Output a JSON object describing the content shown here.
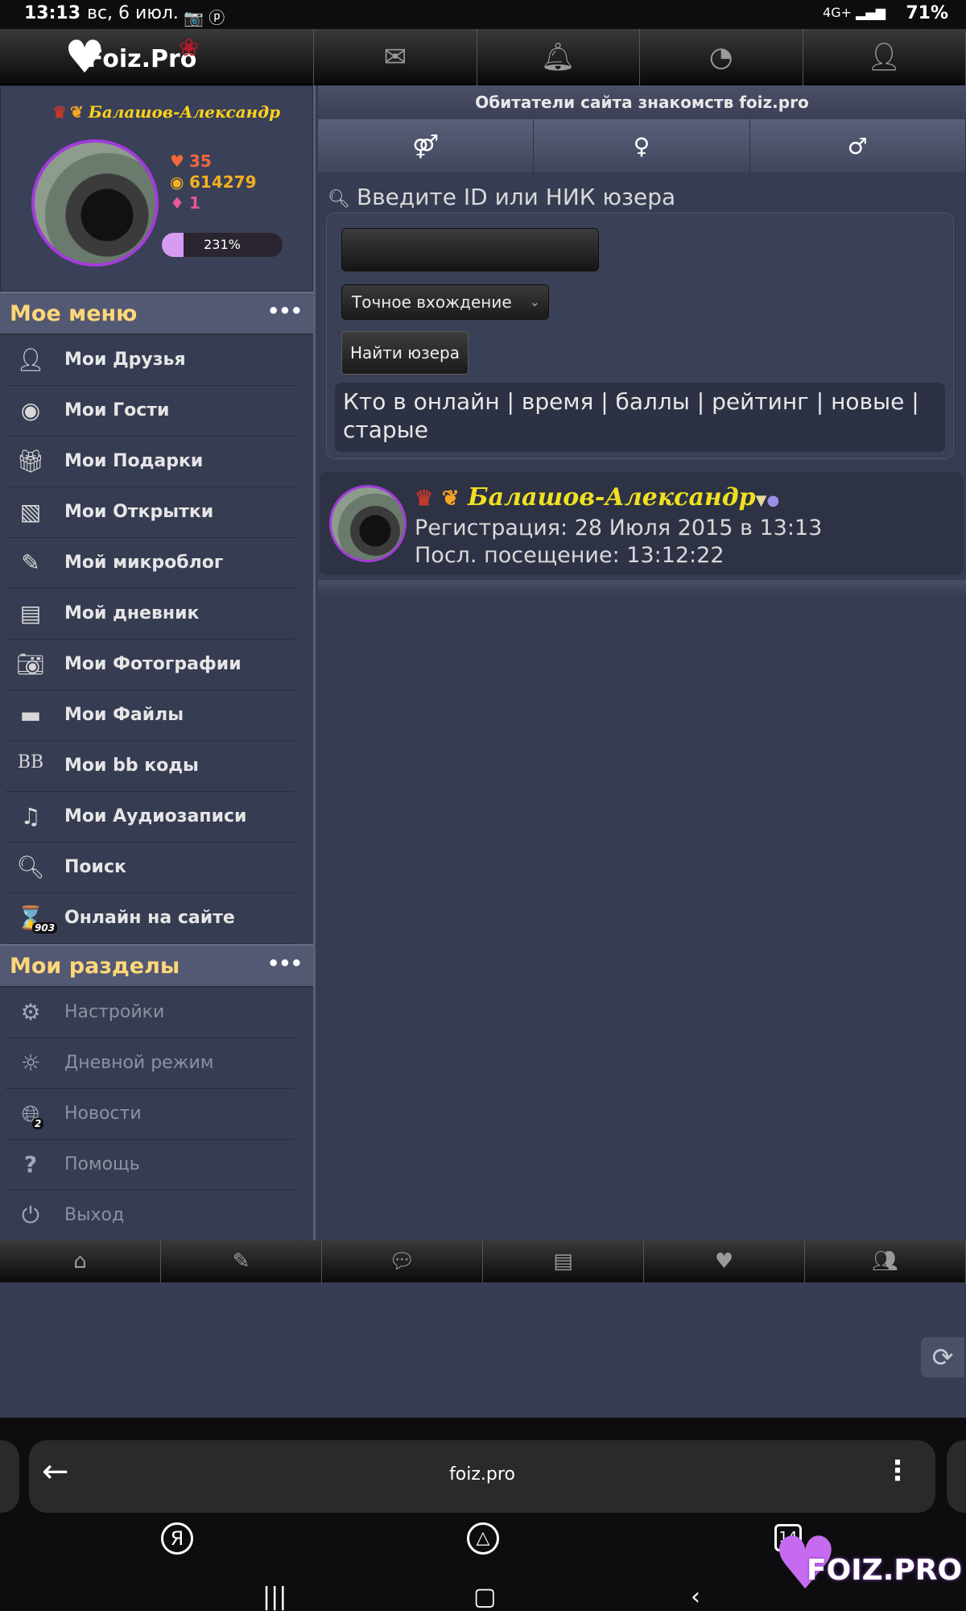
{
  "status": {
    "time": "13:13",
    "date": "вс, 6 июл.",
    "icons": "📷 ⓟ",
    "signal": "4G+ ▂▄▆",
    "battery": "71%"
  },
  "header": {
    "logo_text": "Foiz.Pro",
    "nav_icons": [
      "envelope-icon",
      "bell-icon",
      "rss-icon",
      "user-icon"
    ]
  },
  "profile": {
    "name": "Балашов-Александр",
    "hearts": "35",
    "coins": "614279",
    "gems": "1",
    "progress_label": "231%",
    "progress_fraction": 0.18
  },
  "menu": {
    "title": "Мое меню",
    "dots": "•••",
    "items": [
      {
        "label": "Мои Друзья",
        "icon": "friends-icon"
      },
      {
        "label": "Мои Гости",
        "icon": "eye-icon"
      },
      {
        "label": "Мои Подарки",
        "icon": "gift-icon"
      },
      {
        "label": "Мои Открытки",
        "icon": "postcard-icon"
      },
      {
        "label": "Мой микроблог",
        "icon": "edit-icon"
      },
      {
        "label": "Мой дневник",
        "icon": "book-icon"
      },
      {
        "label": "Мои Фотографии",
        "icon": "camera-icon"
      },
      {
        "label": "Мои Файлы",
        "icon": "folder-icon"
      },
      {
        "label": "Мои bb коды",
        "icon": "bb-icon"
      },
      {
        "label": "Мои Аудиозаписи",
        "icon": "music-icon"
      },
      {
        "label": "Поиск",
        "icon": "search-icon"
      },
      {
        "label": "Онлайн на сайте",
        "icon": "online-icon",
        "badge": "903"
      }
    ]
  },
  "sections": {
    "title": "Мои разделы",
    "dots": "•••",
    "items": [
      {
        "label": "Настройки",
        "icon": "gear-icon"
      },
      {
        "label": "Дневной режим",
        "icon": "sun-icon"
      },
      {
        "label": "Новости",
        "icon": "globe-icon",
        "badge": "2"
      },
      {
        "label": "Помощь",
        "icon": "help-icon"
      },
      {
        "label": "Выход",
        "icon": "power-icon"
      }
    ]
  },
  "main": {
    "title": "Обитатели сайта знакомств foiz.pro",
    "search_caption": "Введите ID или НИК юзера",
    "select_value": "Точное вхождение",
    "search_button": "Найти юзера",
    "sort_links": "Кто в онлайн | время | баллы | рейтинг | новые | старые",
    "user": {
      "name": "Балашов-Александр",
      "registration": "Регистрация: 28 Июля 2015 в 13:13",
      "last_visit": "Посл. посещение: 13:12:22"
    }
  },
  "bottom_nav": [
    "home-icon",
    "pencil-icon",
    "chat-icon",
    "book-icon",
    "heart-icon",
    "group-icon"
  ],
  "browser": {
    "url": "foiz.pro",
    "tabs_count": "14",
    "yandex": "Я"
  },
  "watermark": "FOIZ.PRO"
}
